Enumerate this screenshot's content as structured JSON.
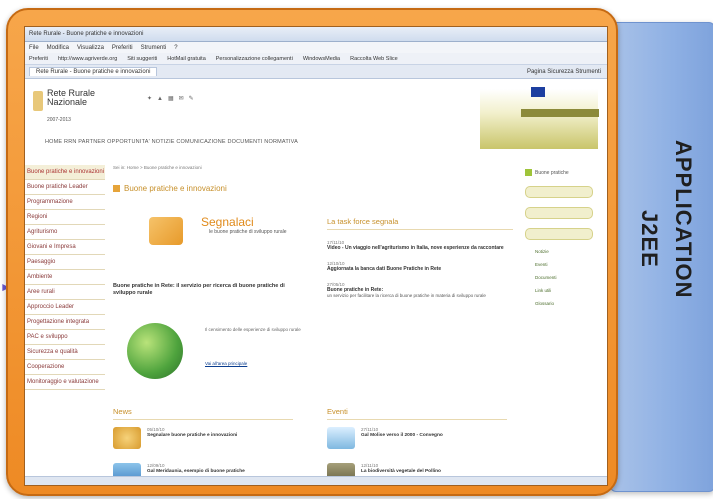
{
  "side_panel": {
    "line1": "APPLICATION",
    "line2": "J2EE"
  },
  "browser": {
    "title": "Rete Rurale - Buone pratiche e innovazioni",
    "menu": [
      "File",
      "Modifica",
      "Visualizza",
      "Preferiti",
      "Strumenti",
      "?"
    ],
    "favorites": [
      "Preferiti",
      "http://www.agriverde.org",
      "Siti suggeriti",
      "HotMail gratuita",
      "Personalizzazione collegamenti",
      "WindowsMedia",
      "Raccolta Web Slice"
    ],
    "tab": "Rete Rurale - Buone pratiche e innovazioni",
    "toolbar": "Pagina  Sicurezza  Strumenti"
  },
  "site": {
    "logo_line1": "Rete Rurale",
    "logo_line2": "Nazionale",
    "logo_years": "2007-2013",
    "nav": "HOME  RRN  PARTNER  OPPORTUNITA'  NOTIZIE  COMUNICAZIONE  DOCUMENTI  NORMATIVA"
  },
  "left_nav": [
    "Buone pratiche e innovazioni",
    "Buone pratiche Leader",
    "Programmazione",
    "Regioni",
    "Agriturismo",
    "Giovani e Impresa",
    "Paesaggio",
    "Ambiente",
    "Aree rurali",
    "Approccio Leader",
    "Progettazione integrata",
    "PAC e sviluppo",
    "Sicurezza e qualità",
    "Cooperazione",
    "Monitoraggio e valutazione"
  ],
  "main": {
    "breadcrumb": "Sei in: Home > Buone pratiche e innovazioni",
    "section_title": "Buone pratiche e innovazioni",
    "segnalaci": "Segnalaci",
    "segnalaci_sub": "le buone pratiche di sviluppo rurale",
    "banner": "Buone pratiche in Rete: il servizio per ricerca di buone pratiche di sviluppo rurale",
    "globe_text": "Il censimento delle esperienze di sviluppo rurale",
    "globe_link": "Vai all'area principale",
    "task_title": "La task force segnala",
    "tasks": [
      {
        "date": "17/11/10",
        "head": "Video - Un viaggio nell'agriturismo in Italia, nove esperienze da raccontare",
        "body": ""
      },
      {
        "date": "12/10/10",
        "head": "Aggiornata la banca dati Buone Pratiche in Rete",
        "body": ""
      },
      {
        "date": "27/05/10",
        "head": "Buone pratiche in Rete:",
        "body": "un servizio per facilitare la ricerca di buone pratiche in materia di sviluppo rurale"
      }
    ],
    "news_title": "News",
    "news": [
      {
        "date": "05/10/10",
        "head": "Segnalare buone pratiche e innovazioni"
      },
      {
        "date": "12/09/10",
        "head": "Gal Meridaunia, esempio di buone pratiche"
      }
    ],
    "events_title": "Eventi",
    "events": [
      {
        "date": "27/11/10",
        "head": "Gal Molise verso il 2000 - Convegno"
      },
      {
        "date": "12/11/10",
        "head": "La biodiversità vegetale del Pollino"
      }
    ]
  },
  "right_col": {
    "top": "Buone pratiche",
    "links": [
      "Notizie",
      "Eventi",
      "Documenti",
      "Link utili",
      "Glossario"
    ]
  }
}
